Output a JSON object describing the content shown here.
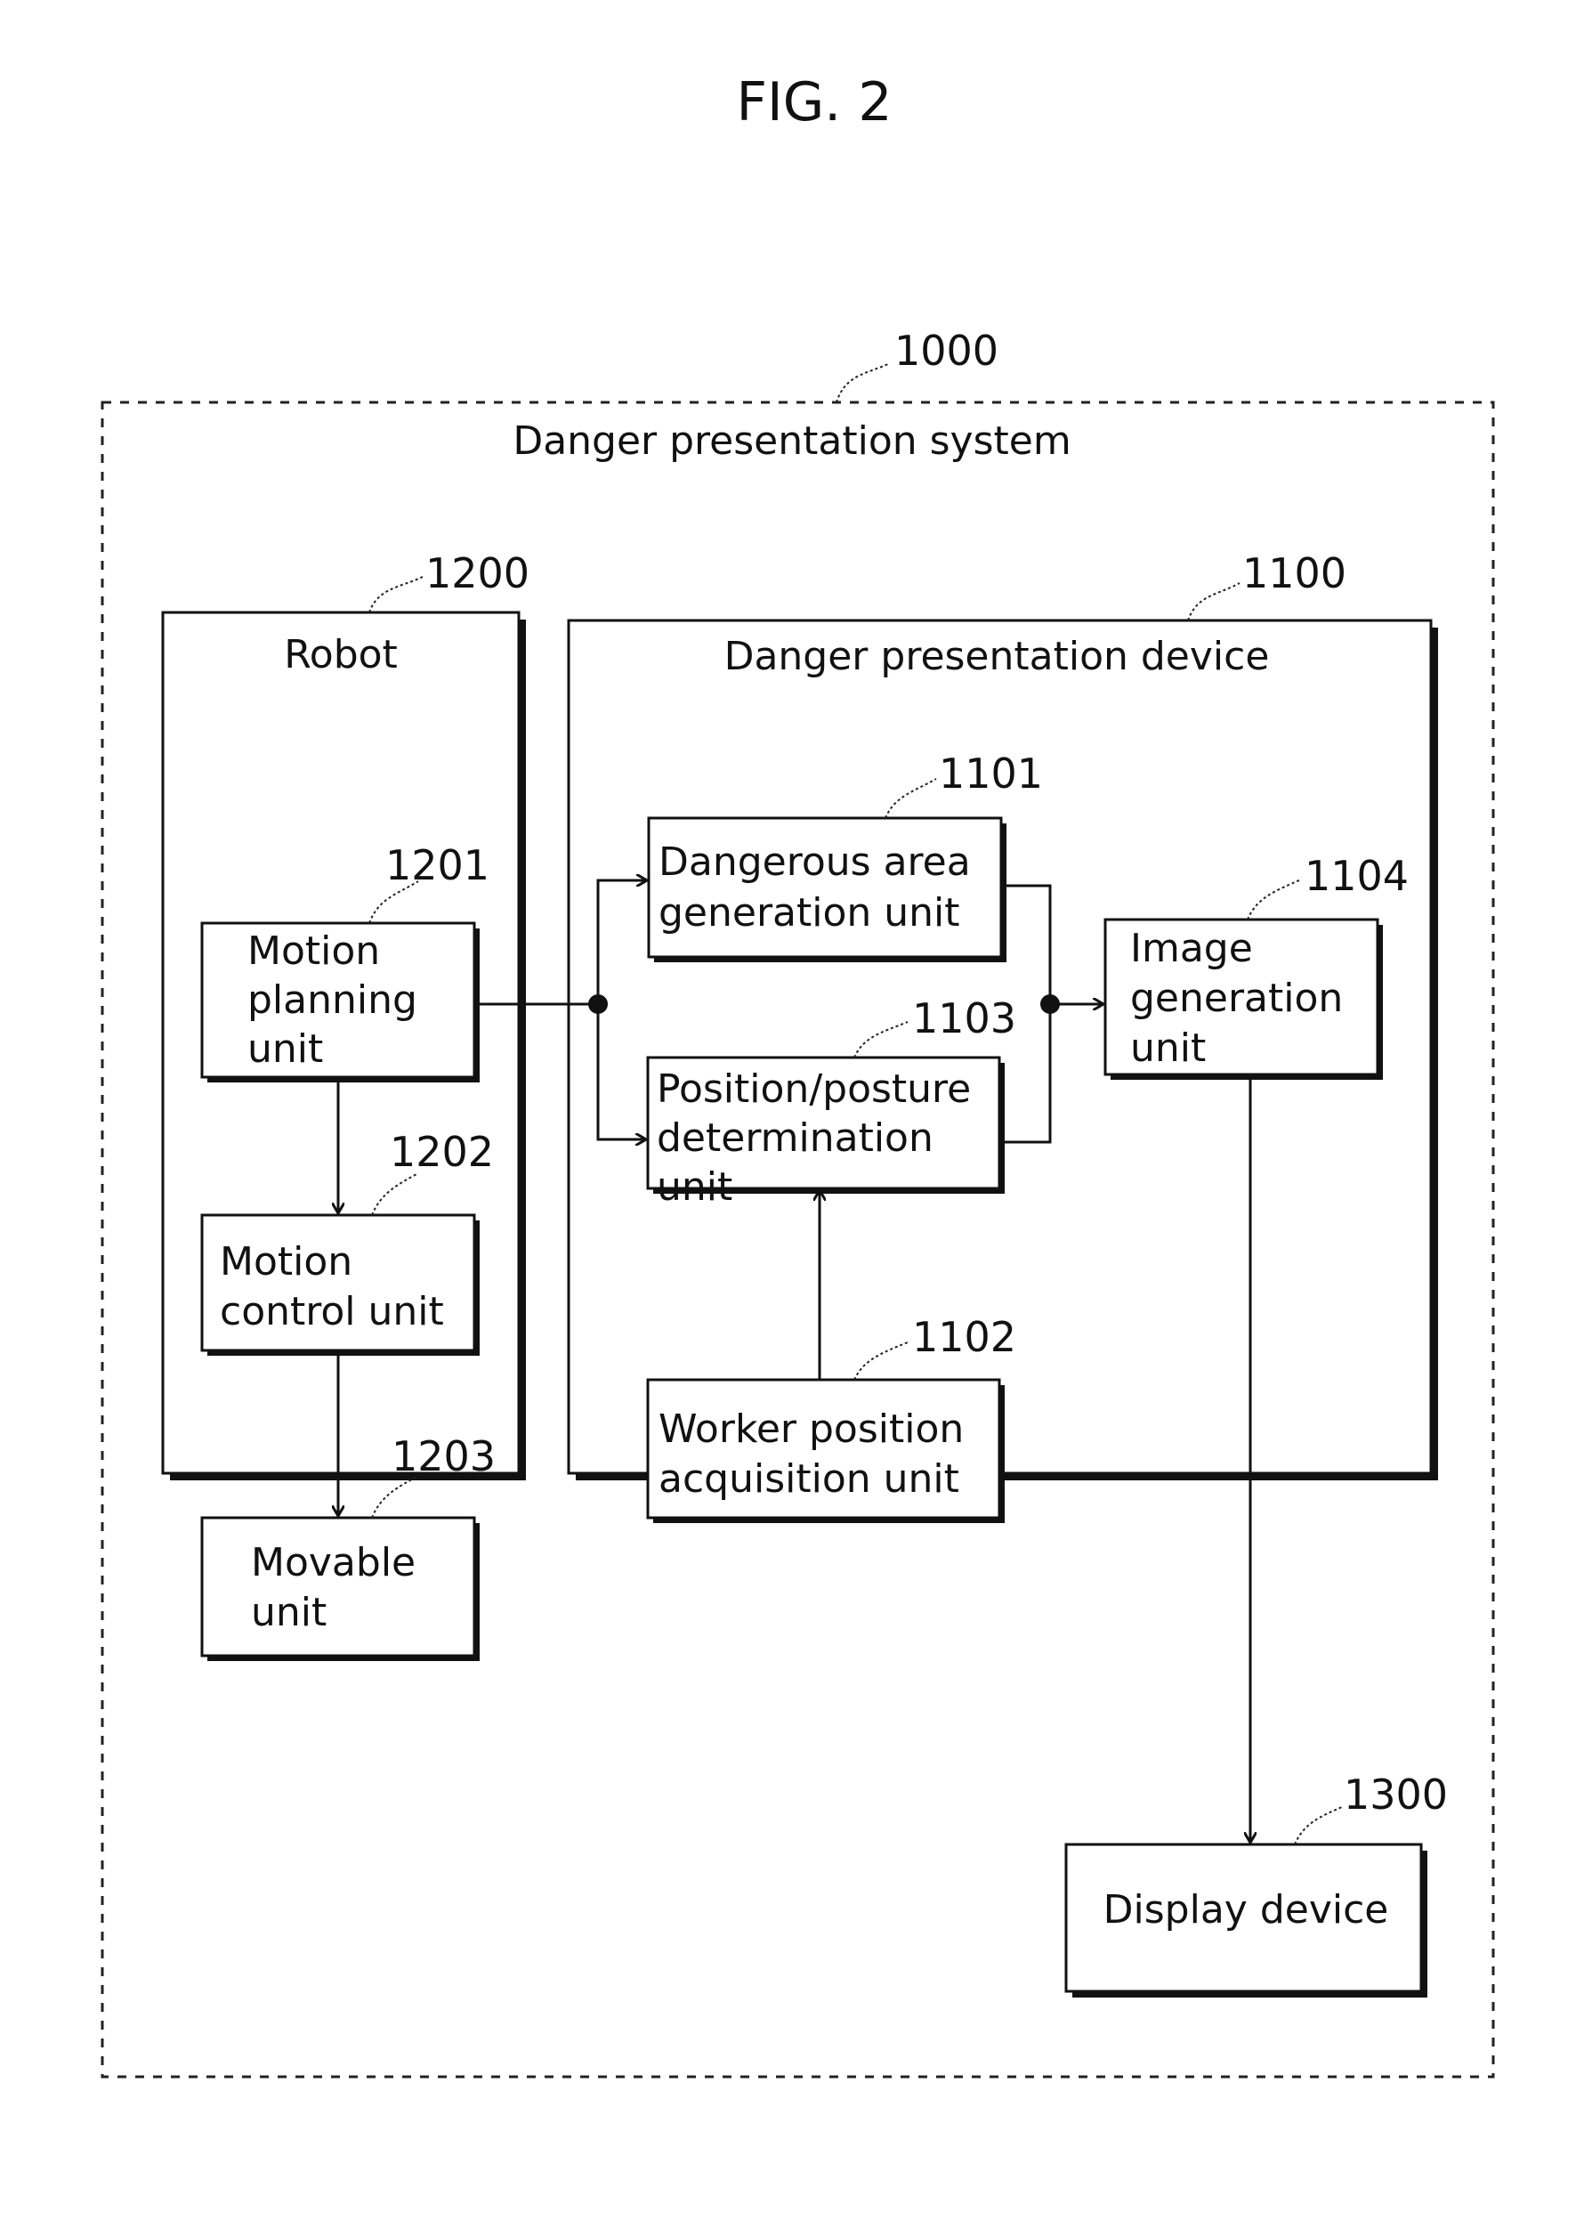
{
  "figure_title": "FIG. 2",
  "system": {
    "ref": "1000",
    "label": "Danger presentation system"
  },
  "robot": {
    "ref": "1200",
    "label": "Robot",
    "units": [
      {
        "ref": "1201",
        "lines": [
          "Motion",
          "planning",
          "unit"
        ]
      },
      {
        "ref": "1202",
        "lines": [
          "Motion",
          "control unit"
        ]
      },
      {
        "ref": "1203",
        "lines": [
          "Movable",
          "unit"
        ]
      }
    ]
  },
  "device": {
    "ref": "1100",
    "label": "Danger presentation device",
    "units": [
      {
        "ref": "1101",
        "lines": [
          "Dangerous area",
          "generation unit"
        ]
      },
      {
        "ref": "1103",
        "lines": [
          "Position/posture",
          "determination",
          "unit"
        ]
      },
      {
        "ref": "1102",
        "lines": [
          "Worker position",
          "acquisition unit"
        ]
      },
      {
        "ref": "1104",
        "lines": [
          "Image",
          "generation",
          "unit"
        ]
      }
    ]
  },
  "display": {
    "ref": "1300",
    "label": "Display device"
  },
  "colors": {
    "ink": "#111111",
    "background": "#ffffff"
  }
}
